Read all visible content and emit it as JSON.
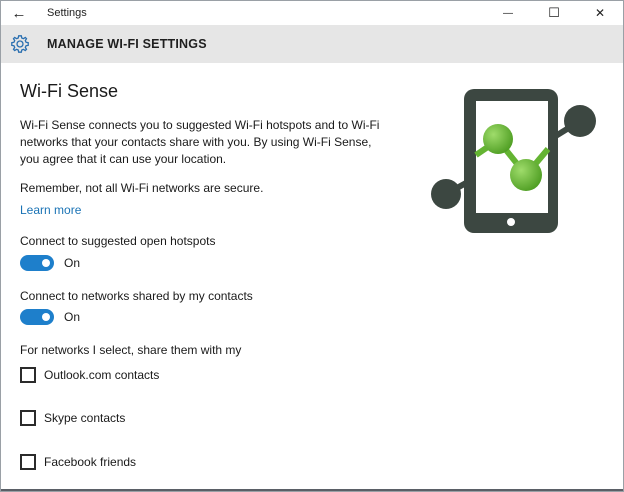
{
  "window": {
    "back_glyph": "←",
    "title": "Settings",
    "minimize_glyph": "—",
    "maximize_glyph": "☐",
    "close_glyph": "✕"
  },
  "header": {
    "icon": "gear-icon",
    "title": "MANAGE WI-FI SETTINGS"
  },
  "main": {
    "title": "Wi-Fi Sense",
    "description": "Wi-Fi Sense connects you to suggested Wi-Fi hotspots and to Wi-Fi networks that your contacts share with you. By using Wi-Fi Sense, you agree that it can use your location.",
    "note": "Remember, not all Wi-Fi networks are secure.",
    "learn_more": "Learn more",
    "toggles": [
      {
        "label": "Connect to suggested open hotspots",
        "state": "On"
      },
      {
        "label": "Connect to networks shared by my contacts",
        "state": "On"
      }
    ],
    "share_heading": "For networks I select, share them with my",
    "checkboxes": [
      {
        "label": "Outlook.com contacts",
        "checked": false
      },
      {
        "label": "Skype contacts",
        "checked": false
      },
      {
        "label": "Facebook friends",
        "checked": false
      }
    ]
  },
  "colors": {
    "accent": "#1e7fcb",
    "header_bg": "#e6e6e6",
    "link": "#1a73b5",
    "phone": "#3c4741",
    "node_green": "#64b432"
  },
  "illustration": {
    "icon": "phone-network-icon"
  }
}
